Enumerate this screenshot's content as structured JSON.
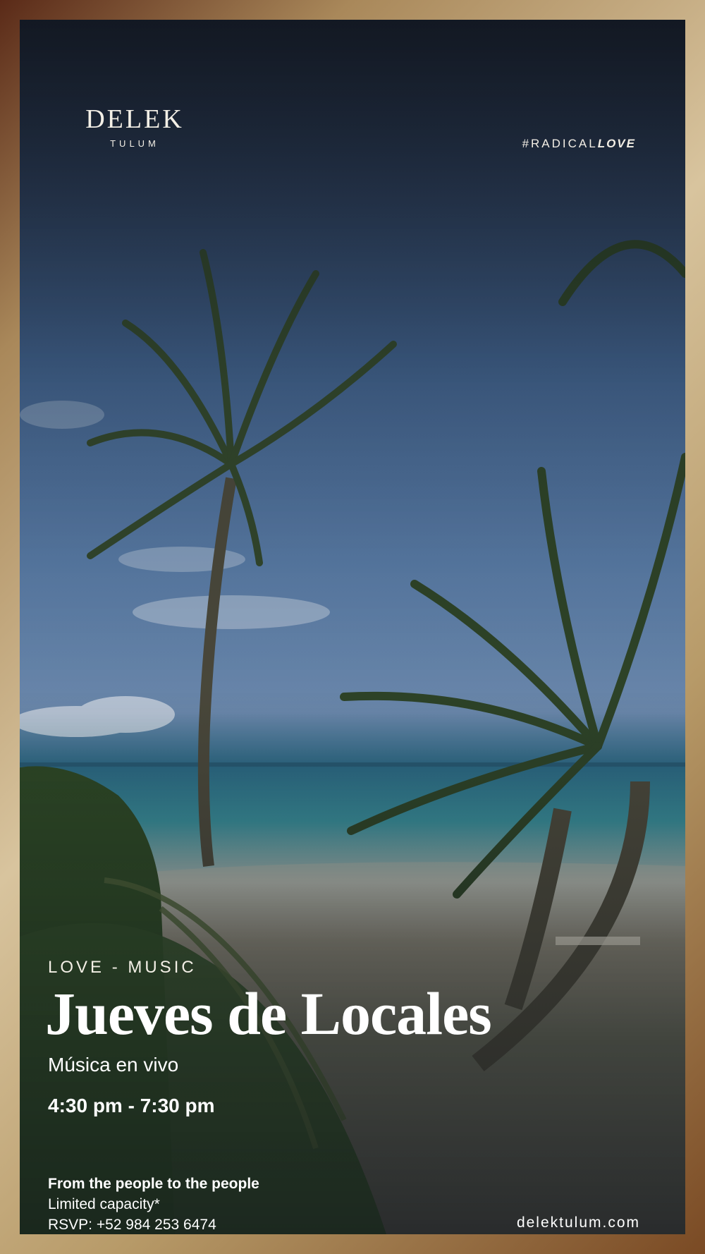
{
  "brand": {
    "name": "DELEK",
    "location": "TULUM",
    "hashtag_prefix": "#RADICAL",
    "hashtag_emphasis": "LOVE"
  },
  "event": {
    "category": "LOVE - MUSIC",
    "title": "Jueves de Locales",
    "subtitle": "Música en vivo",
    "time": "4:30 pm - 7:30 pm"
  },
  "footer": {
    "tagline": "From the people to the people",
    "capacity": "Limited capacity*",
    "rsvp": "RSVP: +52 984 253 6474",
    "website": "delektulum.com"
  },
  "colors": {
    "frame_gold": "#b79a68",
    "text": "#ffffff",
    "sky": "#4d6e98",
    "sea": "#3a8f9a"
  }
}
